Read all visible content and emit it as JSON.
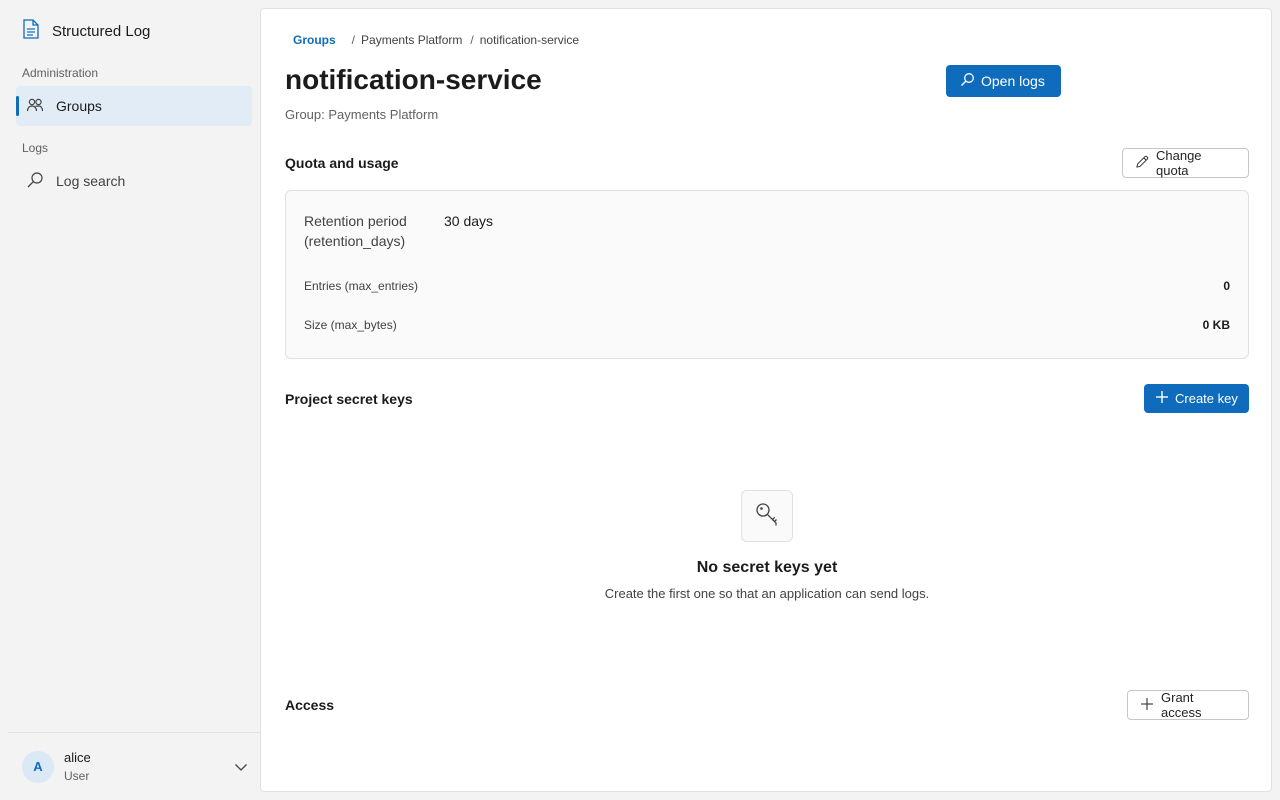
{
  "sidebar": {
    "brand": "Structured Log",
    "sections": [
      {
        "title": "Administration",
        "items": [
          {
            "label": "Groups",
            "icon": "people-icon",
            "active": true
          }
        ]
      },
      {
        "title": "Logs",
        "items": [
          {
            "label": "Log search",
            "icon": "search-icon",
            "active": false
          }
        ]
      }
    ],
    "user": {
      "initial": "A",
      "name": "alice",
      "role": "User"
    }
  },
  "breadcrumb": {
    "root": "Groups",
    "parent": "Payments Platform",
    "current": "notification-service",
    "separator": "/"
  },
  "header": {
    "title": "notification-service",
    "subtitle": "Group: Payments Platform",
    "open_logs_label": "Open logs"
  },
  "quota": {
    "title": "Quota and usage",
    "change_label": "Change quota",
    "retention_label_1": "Retention period",
    "retention_label_2": "(retention_days)",
    "retention_value": "30 days",
    "entries_label": "Entries (max_entries)",
    "entries_value": "0",
    "size_label": "Size (max_bytes)",
    "size_value": "0 KB"
  },
  "keys": {
    "title": "Project secret keys",
    "create_label": "Create key",
    "empty_title": "No secret keys yet",
    "empty_desc": "Create the first one so that an application can send logs."
  },
  "access": {
    "title": "Access",
    "grant_label": "Grant access"
  },
  "colors": {
    "accent": "#0f6cbd",
    "active_nav_bg": "#e1ecf7"
  }
}
